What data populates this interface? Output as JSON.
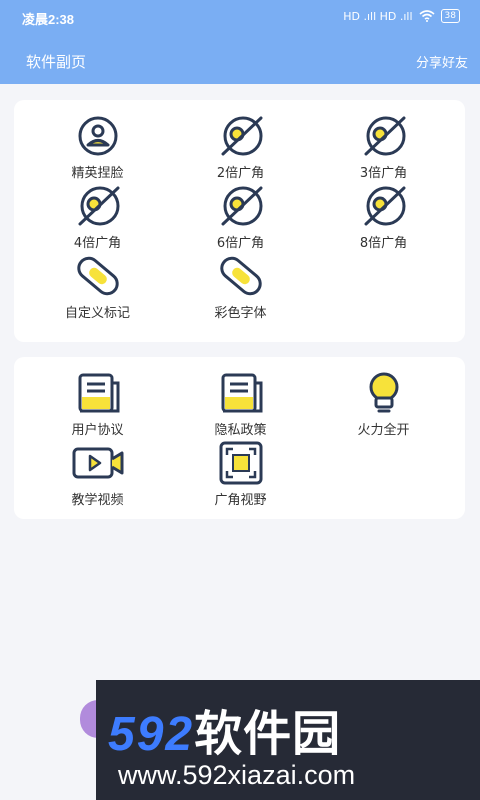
{
  "status_bar": {
    "time": "凌晨2:38",
    "signal": "HD .ıll  HD .ıll",
    "wifi": "wifi-icon",
    "battery": "38"
  },
  "app_bar": {
    "title": "软件副页",
    "share_label": "分享好友"
  },
  "card1": {
    "items": [
      {
        "label": "精英捏脸",
        "icon": "face-icon"
      },
      {
        "label": "2倍广角",
        "icon": "hidden-eye-icon"
      },
      {
        "label": "3倍广角",
        "icon": "hidden-eye-icon"
      },
      {
        "label": "4倍广角",
        "icon": "hidden-eye-icon"
      },
      {
        "label": "6倍广角",
        "icon": "hidden-eye-icon"
      },
      {
        "label": "8倍广角",
        "icon": "hidden-eye-icon"
      },
      {
        "label": "自定义标记",
        "icon": "link-icon"
      },
      {
        "label": "彩色字体",
        "icon": "link-icon"
      }
    ]
  },
  "card2": {
    "items": [
      {
        "label": "用户协议",
        "icon": "document-icon"
      },
      {
        "label": "隐私政策",
        "icon": "document-icon"
      },
      {
        "label": "火力全开",
        "icon": "bulb-icon"
      },
      {
        "label": "教学视频",
        "icon": "video-icon"
      },
      {
        "label": "广角视野",
        "icon": "frame-icon"
      }
    ]
  },
  "watermark": {
    "title_digits": "592",
    "title_cn": "软件园",
    "url": "www.592xiazai.com"
  },
  "colors": {
    "primary": "#7aaef3",
    "accent": "#f7e23a",
    "icon_stroke": "#2b3a55",
    "background": "#f4f5f9"
  }
}
